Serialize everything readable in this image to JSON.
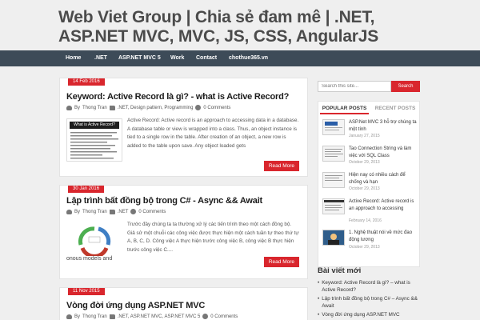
{
  "site": {
    "title": "Web Viet Group | Chia sẻ đam mê | .NET, ASP.NET MVC, MVC, JS, CSS, AngularJS"
  },
  "nav": {
    "items": [
      {
        "label": "Home"
      },
      {
        "label": ".NET"
      },
      {
        "label": "ASP.NET MVC 5"
      },
      {
        "label": "Work"
      },
      {
        "label": "Contact"
      },
      {
        "label": "chothue365.vn"
      }
    ]
  },
  "posts": [
    {
      "date": "14 Feb 2016",
      "title": "Keyword: Active Record là gì? - what is Active Record?",
      "author_prefix": "By",
      "author": "Thong Tran",
      "categories": ".NET, Design pattern, Programming",
      "comments": "0 Comments",
      "thumb_caption": "What is Active Record?",
      "excerpt": "Active Record: Active record is an approach to accessing data in a database. A database table or view is wrapped into a class. Thus, an object instance is tied to a single row in the table. After creation of an object, a new row is added to the table upon save. Any object loaded gets",
      "read_more": "Read More"
    },
    {
      "date": "30 Jan 2016",
      "title": "Lập trình bất đồng bộ trong C# - Async && Await",
      "author_prefix": "By",
      "author": "Thong Tran",
      "categories": ".NET",
      "comments": "0 Comments",
      "thumb_caption": "onous models and",
      "excerpt": "Trước đây chúng ta ta thường xử lý các tiến trình theo một cách đồng bộ. Giả sử một chuỗi các công việc được thực hiện một cách tuần tự theo thứ tự A, B, C, D. Công việc A thực hiện trước công việc B, công việc B thực hiện trước công việc C....",
      "read_more": "Read More"
    },
    {
      "date": "11 Nov 2015",
      "title": "Vòng đời ứng dụng ASP.NET MVC",
      "author_prefix": "By",
      "author": "Thong Tran",
      "categories": ".NET, ASP.NET MVC, ASP.NET MVC 5",
      "comments": "0 Comments"
    }
  ],
  "sidebar": {
    "search": {
      "placeholder": "Search this site...",
      "button": "Search"
    },
    "tabs": {
      "popular": "POPULAR POSTS",
      "recent": "RECENT POSTS"
    },
    "popular_posts": [
      {
        "title": "ASP.Net MVC 3 hỗ trợ chúng ta một tính",
        "date": "January 27, 2015"
      },
      {
        "title": "Tao Connection String và làm việc với SQL Class",
        "date": "October 29, 2013"
      },
      {
        "title": "Hiện nay có nhiều cách để chống và hạn",
        "date": "October 29, 2013"
      },
      {
        "title": "Active Record: Active record is an approach to accessing",
        "date": "February 14, 2016"
      },
      {
        "title": "1. Nghệ thuật nói về mức đao động lương",
        "date": "October 29, 2013"
      }
    ],
    "recent_widget": {
      "title": "Bài viết mới",
      "items": [
        "Keyword: Active Record là gì? – what is Active Record?",
        "Lập trình bất đồng bộ trong C# – Async && Await",
        "Vòng đời ứng dụng ASP.NET MVC"
      ]
    }
  },
  "colors": {
    "accent": "#d9262d",
    "nav_bg": "#3d4b58",
    "page_bg": "#efefef"
  }
}
